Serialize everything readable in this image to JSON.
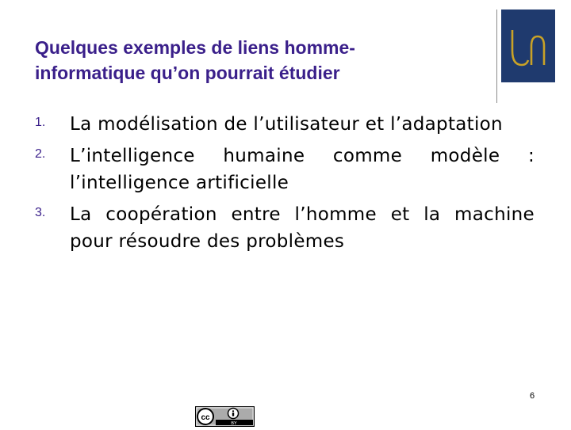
{
  "slide": {
    "title_lines": [
      "Quelques exemples de liens homme-",
      "informatique qu’on pourrait étudier"
    ],
    "items": [
      {
        "number": "1.",
        "text": "La modélisation de l’utilisateur et l’adaptation"
      },
      {
        "number": "2.",
        "text": "L’intelligence humaine comme modèle : l’intelligence artificielle"
      },
      {
        "number": "3.",
        "text": "La coopération entre l’homme et la machine pour résoudre des problèmes"
      }
    ],
    "page_number": "6"
  },
  "colors": {
    "title": "#3a1f8a",
    "logo_background": "#1f3a6e",
    "logo_mark": "#c9a227"
  },
  "logo": {
    "text": "Un"
  },
  "license_badge": {
    "name": "creative-commons-by",
    "label": "BY"
  }
}
